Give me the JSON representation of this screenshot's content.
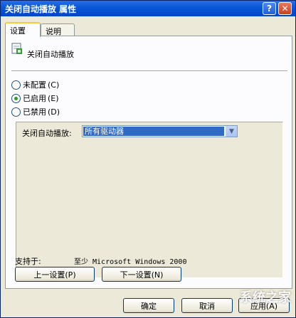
{
  "window": {
    "title": "关闭自动播放 属性",
    "help_glyph": "?",
    "close_glyph": "✕"
  },
  "tabs": [
    {
      "label": "设置",
      "active": true
    },
    {
      "label": "说明",
      "active": false
    }
  ],
  "policy": {
    "name": "关闭自动播放"
  },
  "radios": [
    {
      "label": "未配置",
      "shortcut": "(C)",
      "checked": false
    },
    {
      "label": "已启用",
      "shortcut": "(E)",
      "checked": true
    },
    {
      "label": "已禁用",
      "shortcut": "(D)",
      "checked": false
    }
  ],
  "options": {
    "label": "关闭自动播放:",
    "dropdown_value": "所有驱动器"
  },
  "support": {
    "label": "支持于:",
    "value": "至少 Microsoft Windows 2000"
  },
  "nav": {
    "prev": "上一设置(P)",
    "next": "下一设置(N)"
  },
  "footer": {
    "ok": "确定",
    "cancel": "取消",
    "apply": "应用(A)"
  },
  "watermark": {
    "text": "系统之家"
  },
  "colors": {
    "title_bar": "#0a58d8",
    "selection": "#316ac5",
    "tab_accent": "#ffc83c"
  }
}
